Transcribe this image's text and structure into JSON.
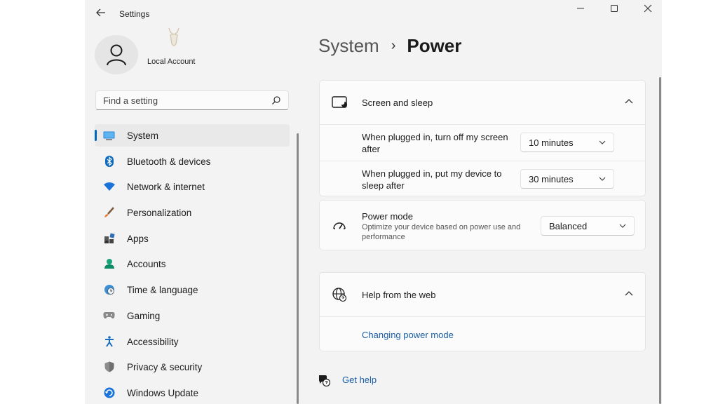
{
  "window": {
    "title": "Settings",
    "back_icon": "arrow-left-icon",
    "controls": [
      "minimize-icon",
      "maximize-icon",
      "close-icon"
    ]
  },
  "profile": {
    "name": "Local Account",
    "avatar_icon": "person-icon"
  },
  "search": {
    "placeholder": "Find a setting",
    "icon": "search-icon"
  },
  "sidebar": {
    "accent": "#0067c0",
    "items": [
      {
        "label": "System",
        "icon": "system-display-icon",
        "active": true
      },
      {
        "label": "Bluetooth & devices",
        "icon": "bluetooth-icon"
      },
      {
        "label": "Network & internet",
        "icon": "wifi-icon"
      },
      {
        "label": "Personalization",
        "icon": "brush-icon"
      },
      {
        "label": "Apps",
        "icon": "apps-icon"
      },
      {
        "label": "Accounts",
        "icon": "accounts-icon"
      },
      {
        "label": "Time & language",
        "icon": "globe-clock-icon"
      },
      {
        "label": "Gaming",
        "icon": "gamepad-icon"
      },
      {
        "label": "Accessibility",
        "icon": "accessibility-icon"
      },
      {
        "label": "Privacy & security",
        "icon": "shield-icon"
      },
      {
        "label": "Windows Update",
        "icon": "update-icon"
      }
    ]
  },
  "breadcrumb": {
    "parent": "System",
    "separator": "›",
    "current": "Power"
  },
  "screen_sleep": {
    "title": "Screen and sleep",
    "rows": [
      {
        "label": "When plugged in, turn off my screen after",
        "value": "10 minutes"
      },
      {
        "label": "When plugged in, put my device to sleep after",
        "value": "30 minutes"
      }
    ]
  },
  "power_mode": {
    "title": "Power mode",
    "description": "Optimize your device based on power use and performance",
    "value": "Balanced"
  },
  "help": {
    "title": "Help from the web",
    "link": "Changing power mode"
  },
  "get_help": {
    "label": "Get help"
  }
}
